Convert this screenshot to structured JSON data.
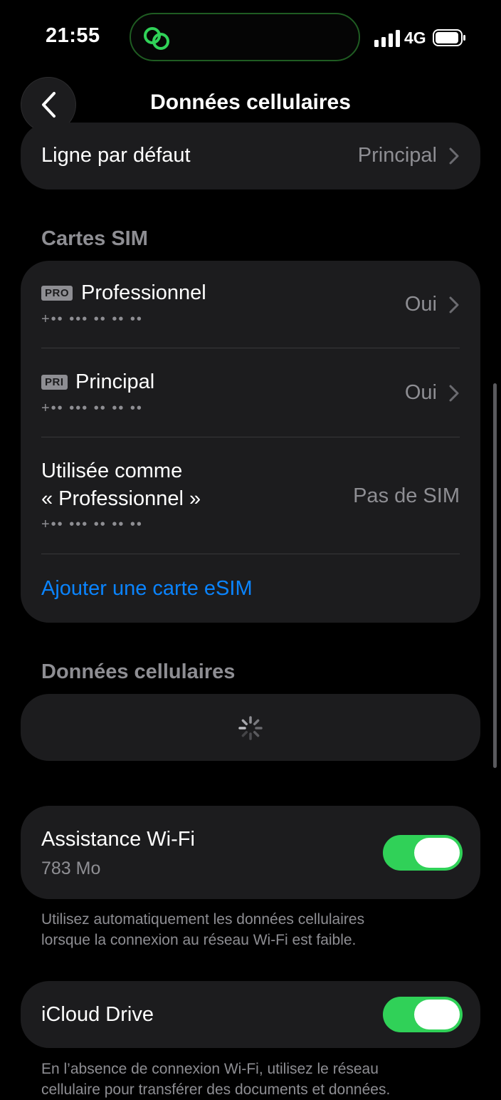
{
  "status_bar": {
    "time": "21:55",
    "network": "4G"
  },
  "nav": {
    "title": "Données cellulaires"
  },
  "default_line": {
    "label": "Ligne par défaut",
    "value": "Principal"
  },
  "sim_section": {
    "header": "Cartes SIM",
    "items": [
      {
        "badge": "PRO",
        "name": "Professionnel",
        "number": "+•• ••• •• •• ••",
        "value": "Oui"
      },
      {
        "badge": "PRI",
        "name": "Principal",
        "number": "+•• ••• •• •• ••",
        "value": "Oui"
      }
    ],
    "used_as": {
      "line1": "Utilisée comme",
      "line2": "« Professionnel »",
      "number": "+•• ••• •• •• ••",
      "value": "Pas de SIM"
    },
    "add_esim": "Ajouter une carte eSIM"
  },
  "data_section": {
    "header": "Données cellulaires"
  },
  "wifi_assist": {
    "label": "Assistance Wi-Fi",
    "usage": "783 Mo",
    "enabled": true,
    "footnote_line1": "Utilisez automatiquement les données cellulaires",
    "footnote_line2": "lorsque la connexion au réseau Wi-Fi est faible."
  },
  "icloud_drive": {
    "label": "iCloud Drive",
    "enabled": true,
    "footnote_line1": "En l’absence de connexion Wi-Fi, utilisez le réseau",
    "footnote_line2": "cellulaire pour transférer des documents et données."
  },
  "colors": {
    "accent_link": "#0a84ff",
    "toggle_on": "#30d158",
    "card_bg": "#1c1c1e",
    "secondary_text": "#8e8e93"
  }
}
